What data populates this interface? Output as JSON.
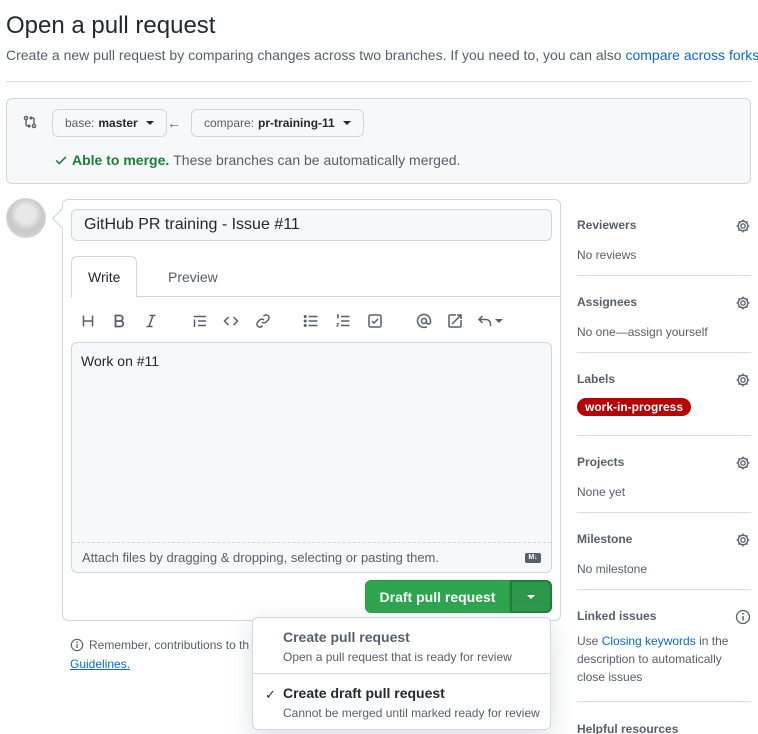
{
  "page": {
    "title": "Open a pull request",
    "subtitle": "Create a new pull request by comparing changes across two branches. If you need to, you can also ",
    "subtitle_link": "compare across forks."
  },
  "range": {
    "base_prefix": "base:",
    "base_branch": "master",
    "compare_prefix": "compare:",
    "compare_branch": "pr-training-11",
    "merge_ok": "Able to merge.",
    "merge_msg": "These branches can be automatically merged."
  },
  "composer": {
    "title_value": "GitHub PR training - Issue #11",
    "tabs": [
      {
        "label": "Write"
      },
      {
        "label": "Preview"
      }
    ],
    "body": "Work on #11",
    "attach_hint": "Attach files by dragging & dropping, selecting or pasting them.",
    "submit_label": "Draft pull request"
  },
  "footer": {
    "remember": "Remember, contributions to th",
    "guidelines": "Guidelines."
  },
  "dropdown": {
    "items": [
      {
        "title": "Create pull request",
        "desc": "Open a pull request that is ready for review",
        "selected": false
      },
      {
        "title": "Create draft pull request",
        "desc": "Cannot be merged until marked ready for review",
        "selected": true
      }
    ]
  },
  "sidebar": {
    "reviewers": {
      "head": "Reviewers",
      "value": "No reviews"
    },
    "assignees": {
      "head": "Assignees",
      "value": "No one—assign yourself"
    },
    "labels": {
      "head": "Labels",
      "label": "work-in-progress",
      "label_color": "#b60205"
    },
    "projects": {
      "head": "Projects",
      "value": "None yet"
    },
    "milestone": {
      "head": "Milestone",
      "value": "No milestone"
    },
    "linked": {
      "head": "Linked issues",
      "pre": "Use ",
      "link": "Closing keywords",
      "post": " in the description to automatically close issues"
    },
    "helpful": {
      "head": "Helpful resources"
    }
  },
  "colors": {
    "primary_button": "#2da44e",
    "link": "#0969da",
    "success": "#1a7f37"
  }
}
